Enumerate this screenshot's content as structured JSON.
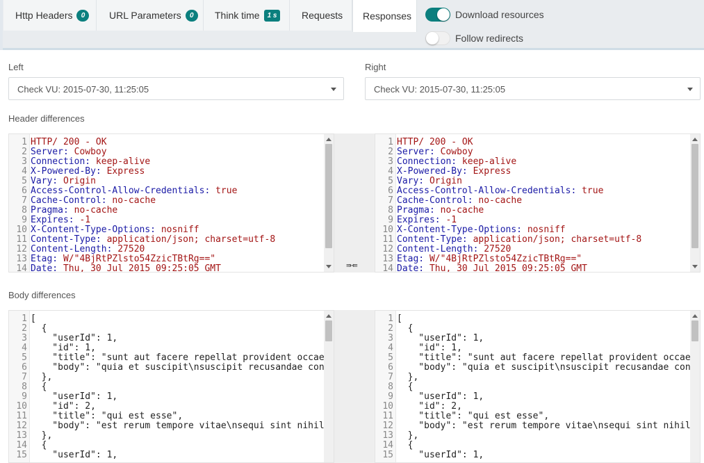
{
  "tabs": [
    {
      "label": "Http Headers",
      "badge": "0"
    },
    {
      "label": "URL Parameters",
      "badge": "0"
    },
    {
      "label": "Think time",
      "badge": "1 s"
    },
    {
      "label": "Requests"
    },
    {
      "label": "Responses"
    }
  ],
  "toggles": {
    "download": {
      "label": "Download resources",
      "on": true
    },
    "follow": {
      "label": "Follow redirects",
      "on": false
    }
  },
  "left": {
    "label": "Left",
    "selected": "Check VU: 2015-07-30, 11:25:05"
  },
  "right": {
    "label": "Right",
    "selected": "Check VU: 2015-07-30, 11:25:05"
  },
  "header_diff_label": "Header differences",
  "body_diff_label": "Body differences",
  "merge_icon": "⇛⇚",
  "header_lines": [
    {
      "n": "1",
      "k": "HTTP/ 200 - OK",
      "v": ""
    },
    {
      "n": "2",
      "k": "Server:",
      "v": " Cowboy"
    },
    {
      "n": "3",
      "k": "Connection:",
      "v": " keep-alive"
    },
    {
      "n": "4",
      "k": "X-Powered-By:",
      "v": " Express"
    },
    {
      "n": "5",
      "k": "Vary:",
      "v": " Origin"
    },
    {
      "n": "6",
      "k": "Access-Control-Allow-Credentials:",
      "v": " true"
    },
    {
      "n": "7",
      "k": "Cache-Control:",
      "v": " no-cache"
    },
    {
      "n": "8",
      "k": "Pragma:",
      "v": " no-cache"
    },
    {
      "n": "9",
      "k": "Expires:",
      "v": " -1"
    },
    {
      "n": "10",
      "k": "X-Content-Type-Options:",
      "v": " nosniff"
    },
    {
      "n": "11",
      "k": "Content-Type:",
      "v": " application/json; charset=utf-8"
    },
    {
      "n": "12",
      "k": "Content-Length:",
      "v": " 27520"
    },
    {
      "n": "13",
      "k": "Etag:",
      "v": " W/\"4BjRtPZlsto54ZzicTBtRg==\""
    },
    {
      "n": "14",
      "k": "Date:",
      "v": " Thu, 30 Jul 2015 09:25:05 GMT"
    }
  ],
  "body_lines": [
    {
      "n": "1",
      "t": "["
    },
    {
      "n": "2",
      "t": "  {"
    },
    {
      "n": "3",
      "t": "    \"userId\": 1,"
    },
    {
      "n": "4",
      "t": "    \"id\": 1,"
    },
    {
      "n": "5",
      "t": "    \"title\": \"sunt aut facere repellat provident occaecati excepturi optio reprehenderit\","
    },
    {
      "n": "6",
      "t": "    \"body\": \"quia et suscipit\\nsuscipit recusandae consequuntur expedita et cum\""
    },
    {
      "n": "7",
      "t": "  },"
    },
    {
      "n": "8",
      "t": "  {"
    },
    {
      "n": "9",
      "t": "    \"userId\": 1,"
    },
    {
      "n": "10",
      "t": "    \"id\": 2,"
    },
    {
      "n": "11",
      "t": "    \"title\": \"qui est esse\","
    },
    {
      "n": "12",
      "t": "    \"body\": \"est rerum tempore vitae\\nsequi sint nihil reprehenderit\""
    },
    {
      "n": "13",
      "t": "  },"
    },
    {
      "n": "14",
      "t": "  {"
    },
    {
      "n": "15",
      "t": "    \"userId\": 1,"
    }
  ]
}
